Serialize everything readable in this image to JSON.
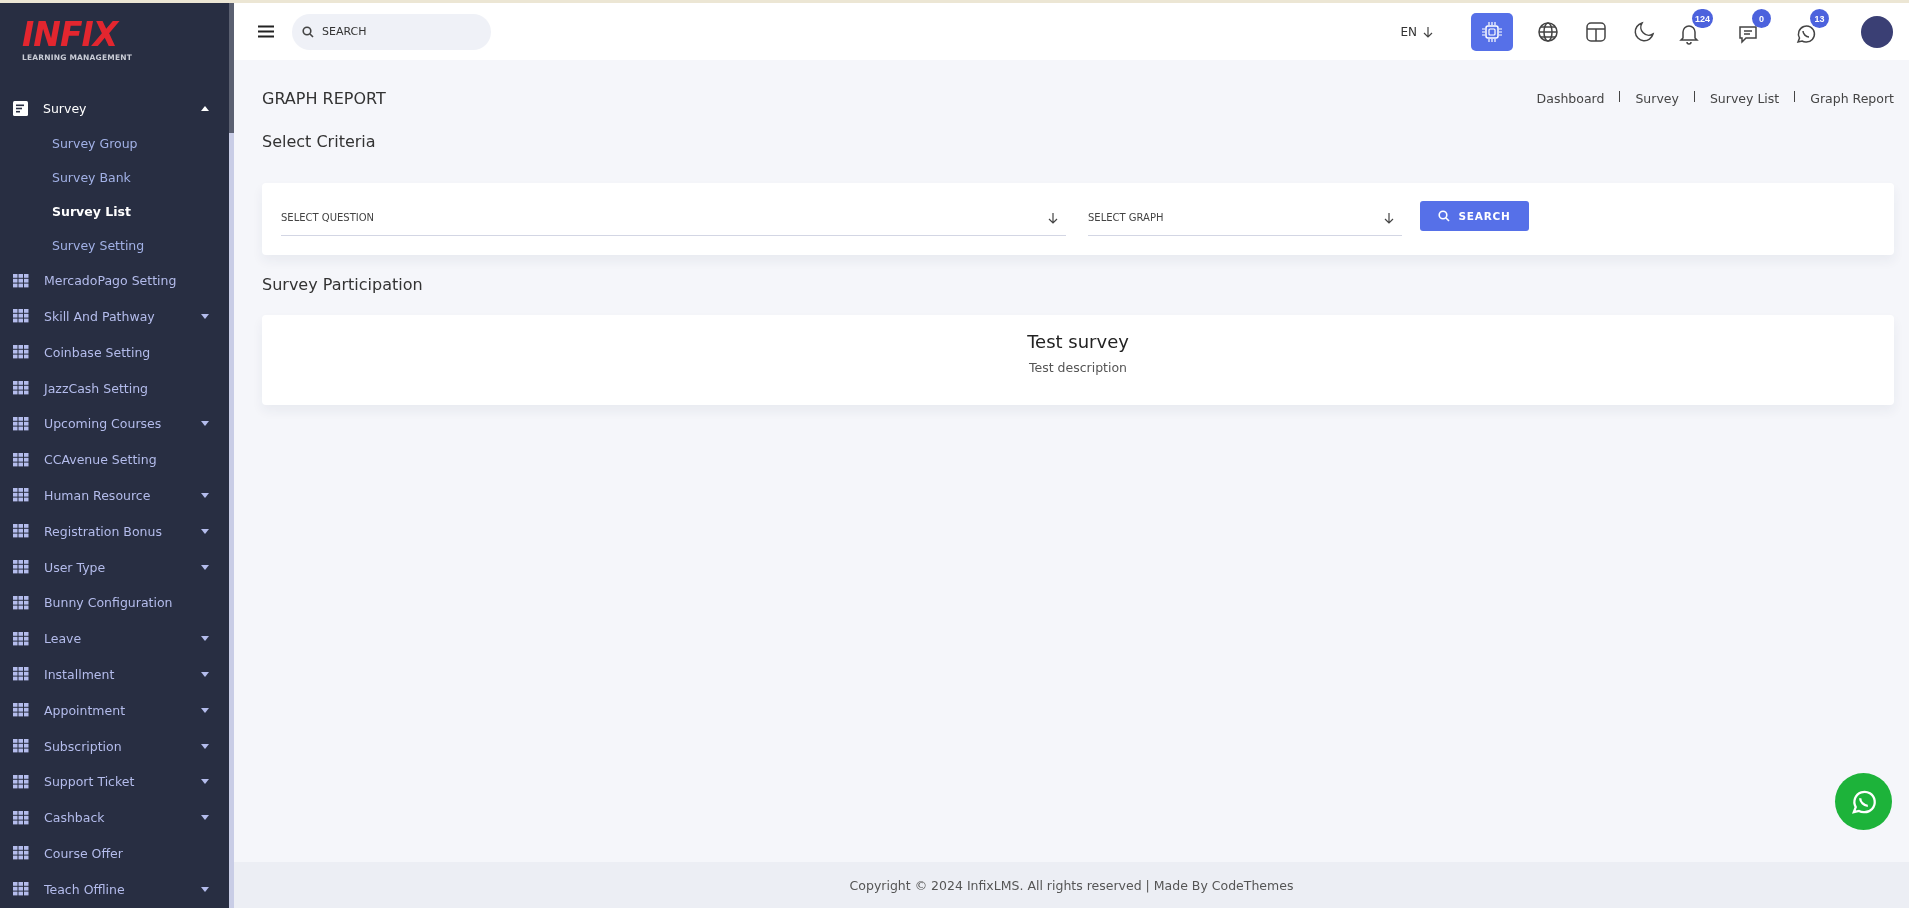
{
  "sidebar": {
    "logo": {
      "title": "INFIX",
      "subtitle": "LEARNING MANAGEMENT"
    },
    "items": [
      {
        "label": "Survey",
        "kind": "group",
        "active": true,
        "expanded": true,
        "children": [
          {
            "label": "Survey Group",
            "selected": false
          },
          {
            "label": "Survey Bank",
            "selected": false
          },
          {
            "label": "Survey List",
            "selected": true
          },
          {
            "label": "Survey Setting",
            "selected": false
          }
        ]
      },
      {
        "label": "MercadoPago Setting",
        "kind": "link",
        "active": false
      },
      {
        "label": "Skill And Pathway",
        "kind": "group",
        "active": false,
        "expanded": false
      },
      {
        "label": "Coinbase Setting",
        "kind": "link",
        "active": false
      },
      {
        "label": "JazzCash Setting",
        "kind": "link",
        "active": false
      },
      {
        "label": "Upcoming Courses",
        "kind": "group",
        "active": false,
        "expanded": false
      },
      {
        "label": "CCAvenue Setting",
        "kind": "link",
        "active": false
      },
      {
        "label": "Human Resource",
        "kind": "group",
        "active": false,
        "expanded": false
      },
      {
        "label": "Registration Bonus",
        "kind": "group",
        "active": false,
        "expanded": false
      },
      {
        "label": "User Type",
        "kind": "group",
        "active": false,
        "expanded": false
      },
      {
        "label": "Bunny Configuration",
        "kind": "link",
        "active": false
      },
      {
        "label": "Leave",
        "kind": "group",
        "active": false,
        "expanded": false
      },
      {
        "label": "Installment",
        "kind": "group",
        "active": false,
        "expanded": false
      },
      {
        "label": "Appointment",
        "kind": "group",
        "active": false,
        "expanded": false
      },
      {
        "label": "Subscription",
        "kind": "group",
        "active": false,
        "expanded": false
      },
      {
        "label": "Support Ticket",
        "kind": "group",
        "active": false,
        "expanded": false
      },
      {
        "label": "Cashback",
        "kind": "group",
        "active": false,
        "expanded": false
      },
      {
        "label": "Course Offer",
        "kind": "link",
        "active": false
      },
      {
        "label": "Teach Offline",
        "kind": "group",
        "active": false,
        "expanded": false
      }
    ]
  },
  "header": {
    "search": {
      "placeholder": "SEARCH"
    },
    "language": "EN",
    "badges": [
      {
        "kind": "bell",
        "count": "124"
      },
      {
        "kind": "chat",
        "count": "0"
      },
      {
        "kind": "whatsapp",
        "count": "13"
      }
    ]
  },
  "page": {
    "title": "GRAPH REPORT",
    "breadcrumbs": [
      "Dashboard",
      "Survey",
      "Survey List",
      "Graph Report"
    ],
    "criteria": {
      "heading": "Select Criteria",
      "fields": [
        {
          "label": "SELECT QUESTION"
        },
        {
          "label": "SELECT GRAPH"
        }
      ],
      "button": "SEARCH"
    },
    "participation": {
      "heading": "Survey Participation",
      "title": "Test survey",
      "description": "Test description"
    }
  },
  "footer": "Copyright © 2024 InfixLMS. All rights reserved | Made By CodeThemes"
}
